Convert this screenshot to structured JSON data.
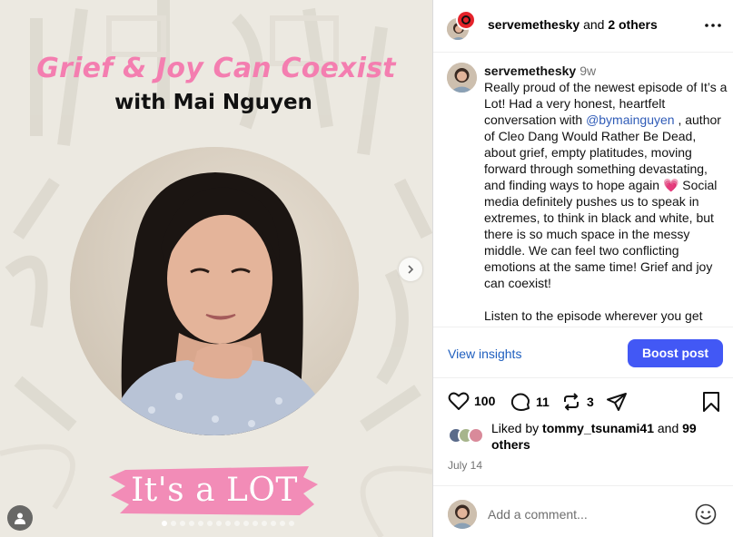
{
  "media": {
    "title": "Grief & Joy Can Coexist",
    "subtitle": "with Mai Nguyen",
    "banner_text": "It's a LOT"
  },
  "header": {
    "username": "servemethesky",
    "and_text": "and",
    "others": "2 others"
  },
  "caption": {
    "username": "servemethesky",
    "time": "9w",
    "text_part1": "Really proud of the newest episode of It’s a Lot! Had a very honest, heartfelt conversation with ",
    "mention": "@bymainguyen",
    "text_part2": " , author of Cleo Dang Would Rather Be Dead, about grief, empty platitudes, moving forward through something devastating, and finding ways to hope again ",
    "emoji": "💗",
    "text_part3": " Social media definitely pushes us to speak in extremes, to think in black and white, but there is so much space in the messy middle. We can feel two conflicting emotions at the same time! Grief and joy can coexist!",
    "text_part4": "Listen to the episode wherever you get"
  },
  "insights": {
    "view_label": "View insights",
    "boost_label": "Boost post"
  },
  "actions": {
    "likes_count": "100",
    "comments_count": "11",
    "reposts_count": "3"
  },
  "liked_by": {
    "prefix": "Liked by ",
    "user": "tommy_tsunami41",
    "middle": " and ",
    "others": "99 others"
  },
  "date": "July 14",
  "comment": {
    "placeholder": "Add a comment..."
  },
  "colors": {
    "accent_blue": "#4258f5",
    "link_blue": "#2f5bb7",
    "title_pink": "#f47eb0",
    "banner_pink": "#f28cb7"
  }
}
